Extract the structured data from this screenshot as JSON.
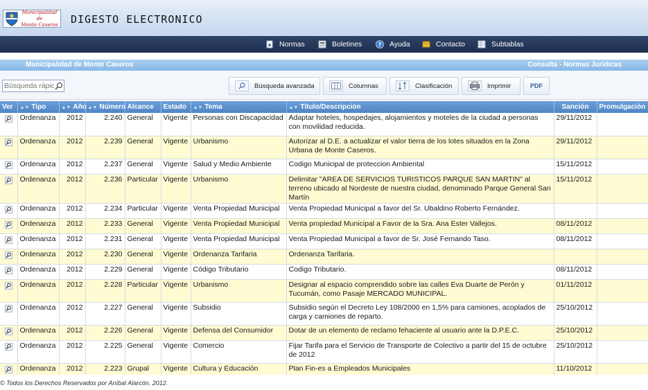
{
  "header": {
    "logo_text_line1": "Municipalidad de",
    "logo_text_line2": "Monte Caseros",
    "title": "DIGESTO ELECTRONICO"
  },
  "nav": {
    "items": [
      {
        "label": "Normas",
        "icon": "document-icon"
      },
      {
        "label": "Boletines",
        "icon": "newspaper-icon"
      },
      {
        "label": "Ayuda",
        "icon": "help-icon"
      },
      {
        "label": "Contacto",
        "icon": "mail-icon"
      },
      {
        "label": "Subtablas",
        "icon": "table-icon"
      }
    ]
  },
  "strip": {
    "left": "Municipalidad de Monte Caseros",
    "right": "Consulta - Normas Juridicas"
  },
  "toolbar": {
    "search_placeholder": "Búsqueda rápida",
    "buttons": [
      {
        "label": "Búsqueda avanzada",
        "icon": "search-icon"
      },
      {
        "label": "Columnas",
        "icon": "columns-icon"
      },
      {
        "label": "Clasificación",
        "icon": "sort-icon"
      },
      {
        "label": "Imprimir",
        "icon": "printer-icon"
      },
      {
        "label": "PDF",
        "icon": "pdf-icon"
      }
    ]
  },
  "table": {
    "columns": [
      "Ver",
      "Tipo",
      "Año",
      "Número",
      "Alcance",
      "Estado",
      "Tema",
      "Título/Descripción",
      "Sanción",
      "Promulgación"
    ],
    "rows": [
      {
        "tipo": "Ordenanza",
        "anio": "2012",
        "numero": "2.240",
        "alcance": "General",
        "estado": "Vigente",
        "tema": "Personas con Discapacidad",
        "titulo": "Adaptar hoteles, hospedajes, alojamientos y moteles de la ciudad a personas con movilidad reducida.",
        "sancion": "29/11/2012",
        "promulgacion": ""
      },
      {
        "tipo": "Ordenanza",
        "anio": "2012",
        "numero": "2.239",
        "alcance": "General",
        "estado": "Vigente",
        "tema": "Urbanismo",
        "titulo": "Autorizar al D.E. a actualizar el valor tierra de los lotes situados en la Zona Urbana de Monte Caseros.",
        "sancion": "29/11/2012",
        "promulgacion": ""
      },
      {
        "tipo": "Ordenanza",
        "anio": "2012",
        "numero": "2.237",
        "alcance": "General",
        "estado": "Vigente",
        "tema": "Salud y Medio Ambiente",
        "titulo": "Codigo Municipal de proteccion Ambiental",
        "sancion": "15/11/2012",
        "promulgacion": ""
      },
      {
        "tipo": "Ordenanza",
        "anio": "2012",
        "numero": "2.236",
        "alcance": "Particular",
        "estado": "Vigente",
        "tema": "Urbanismo",
        "titulo": "Delimitar \"AREA DE SERVICIOS TURISTICOS PARQUE SAN MARTIN\" al terreno ubicado al Nordeste de nuestra ciudad, denominado Parque General San Martín",
        "sancion": "15/11/2012",
        "promulgacion": ""
      },
      {
        "tipo": "Ordenanza",
        "anio": "2012",
        "numero": "2.234",
        "alcance": "Particular",
        "estado": "Vigente",
        "tema": "Venta Propiedad Municipal",
        "titulo": "Venta Propiedad Municipal a favor del Sr. Ubaldino Roberto Fernández.",
        "sancion": "",
        "promulgacion": ""
      },
      {
        "tipo": "Ordenanza",
        "anio": "2012",
        "numero": "2.233",
        "alcance": "General",
        "estado": "Vigente",
        "tema": "Venta Propiedad Municipal",
        "titulo": "Venta propiedad Municipal a Favor de la Sra. Ana Ester Vallejos.",
        "sancion": "08/11/2012",
        "promulgacion": ""
      },
      {
        "tipo": "Ordenanza",
        "anio": "2012",
        "numero": "2.231",
        "alcance": "General",
        "estado": "Vigente",
        "tema": "Venta Propiedad Municipal",
        "titulo": "Venta Propiedad Municipal a favor de Sr. José Fernando Taso.",
        "sancion": "08/11/2012",
        "promulgacion": ""
      },
      {
        "tipo": "Ordenanza",
        "anio": "2012",
        "numero": "2.230",
        "alcance": "General",
        "estado": "Vigente",
        "tema": "Ordenanza Tarifaria",
        "titulo": "Ordenanza Tarifaria.",
        "sancion": "",
        "promulgacion": ""
      },
      {
        "tipo": "Ordenanza",
        "anio": "2012",
        "numero": "2.229",
        "alcance": "General",
        "estado": "Vigente",
        "tema": "Código Tributario",
        "titulo": "Codigo Tributario.",
        "sancion": "08/11/2012",
        "promulgacion": ""
      },
      {
        "tipo": "Ordenanza",
        "anio": "2012",
        "numero": "2.228",
        "alcance": "Particular",
        "estado": "Vigente",
        "tema": "Urbanismo",
        "titulo": "Designar al espacio comprendido sobre las calles Eva Duarte de Perón y Tucumán, como Pasaje MERCADO MUNICIPAL.",
        "sancion": "01/11/2012",
        "promulgacion": ""
      },
      {
        "tipo": "Ordenanza",
        "anio": "2012",
        "numero": "2.227",
        "alcance": "General",
        "estado": "Vigente",
        "tema": "Subsidio",
        "titulo": "Subsidio según el Decreto Ley 108/2000 en 1,5% para camiones, acoplados de carga y camiones de reparto.",
        "sancion": "25/10/2012",
        "promulgacion": ""
      },
      {
        "tipo": "Ordenanza",
        "anio": "2012",
        "numero": "2.226",
        "alcance": "General",
        "estado": "Vigente",
        "tema": "Defensa del Consumidor",
        "titulo": "Dotar de un elemento de reclamo fehaciente al usuario ante la D.P.E.C.",
        "sancion": "25/10/2012",
        "promulgacion": ""
      },
      {
        "tipo": "Ordenanza",
        "anio": "2012",
        "numero": "2.225",
        "alcance": "General",
        "estado": "Vigente",
        "tema": "Comercio",
        "titulo": "Fijar Tarifa para el Servicio de Transporte de Colectivo a partir del 15 de octubre de 2012",
        "sancion": "25/10/2012",
        "promulgacion": ""
      },
      {
        "tipo": "Ordenanza",
        "anio": "2012",
        "numero": "2.223",
        "alcance": "Grupal",
        "estado": "Vigente",
        "tema": "Cultura y Educación",
        "titulo": "Plan Fin-es a Empleados Municipales",
        "sancion": "11/10/2012",
        "promulgacion": ""
      }
    ]
  },
  "footer": "© Todos los Derechos Reservados por Aníbal Alarcón. 2012.",
  "colors": {
    "nav_bg": "#24375a",
    "strip_bg": "#94c1ea",
    "header_row_bg": "#5b8fcc",
    "alt_row_bg": "#fffbd3"
  }
}
